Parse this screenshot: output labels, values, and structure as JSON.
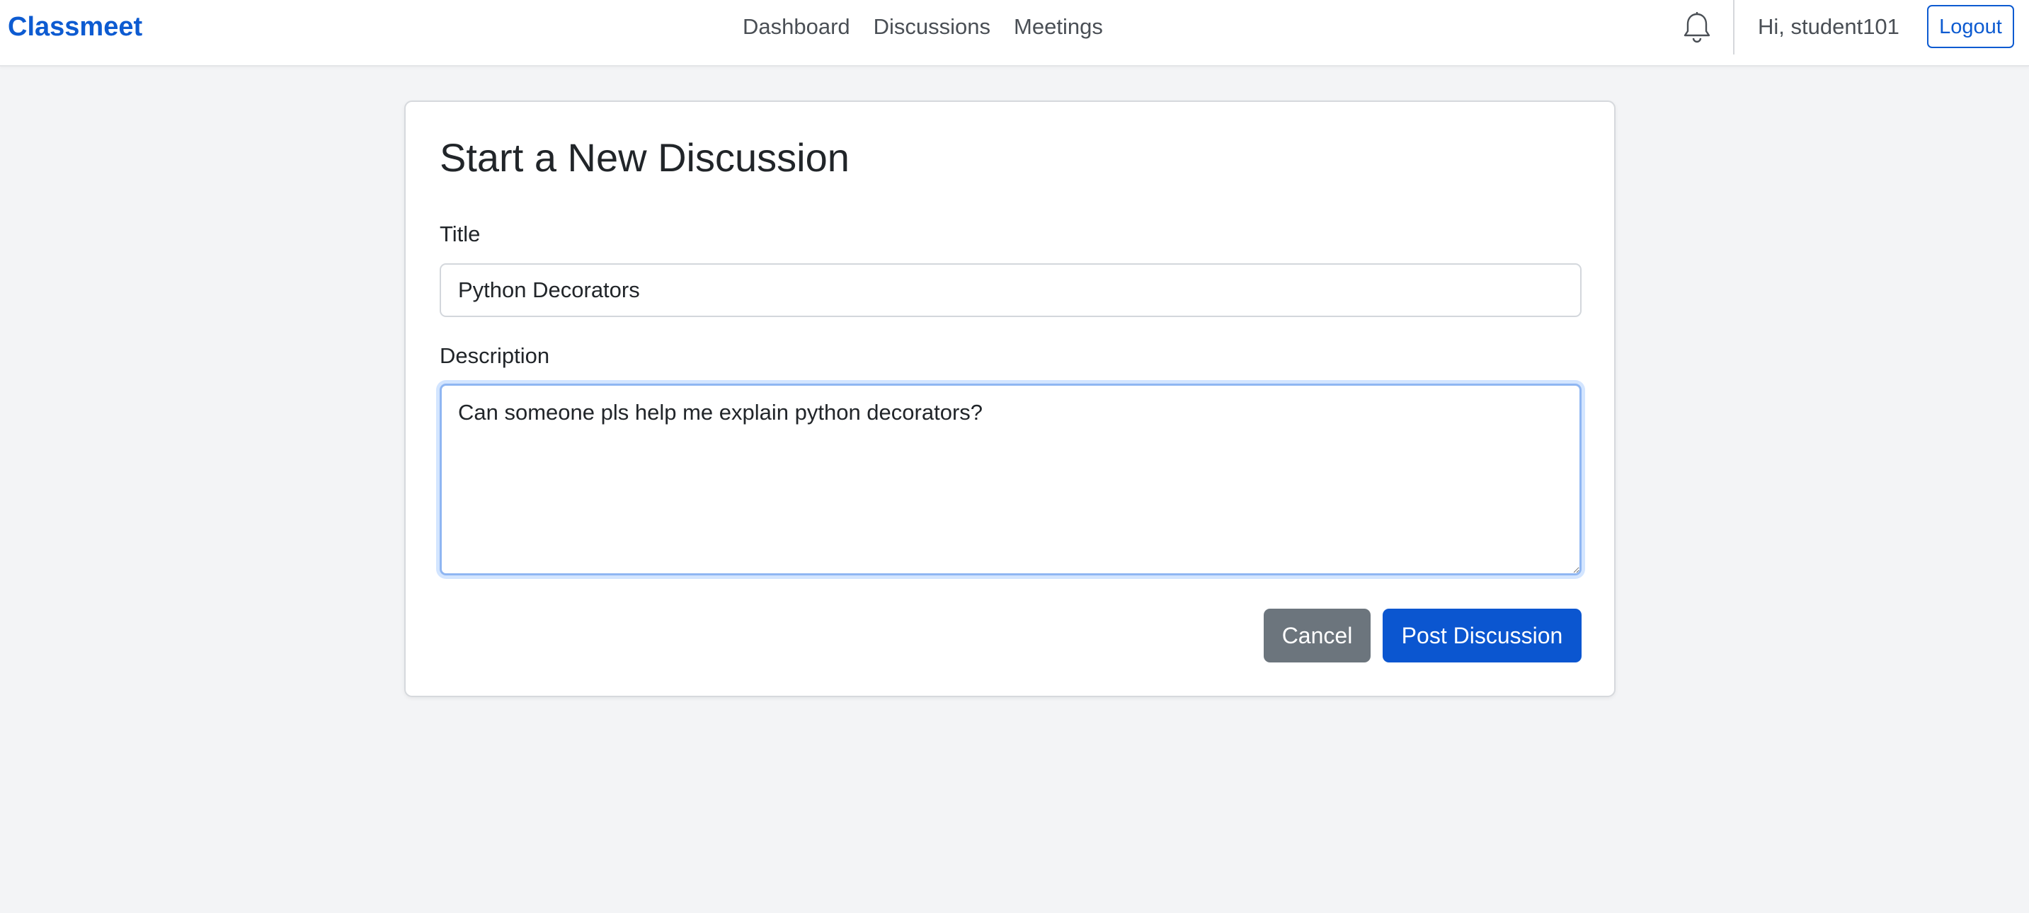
{
  "navbar": {
    "brand": "Classmeet",
    "links": [
      {
        "label": "Dashboard"
      },
      {
        "label": "Discussions"
      },
      {
        "label": "Meetings"
      }
    ],
    "notification_icon": "bell-icon",
    "greeting": "Hi, student101",
    "logout_label": "Logout"
  },
  "form": {
    "heading": "Start a New Discussion",
    "title_label": "Title",
    "title_value": "Python Decorators",
    "description_label": "Description",
    "description_value": "Can someone pls help me explain python decorators?",
    "cancel_label": "Cancel",
    "submit_label": "Post Discussion"
  },
  "colors": {
    "brand": "#0d5bd1",
    "primary_button": "#0b56d0",
    "secondary_button": "#6c757d",
    "page_background": "#f3f4f6"
  }
}
